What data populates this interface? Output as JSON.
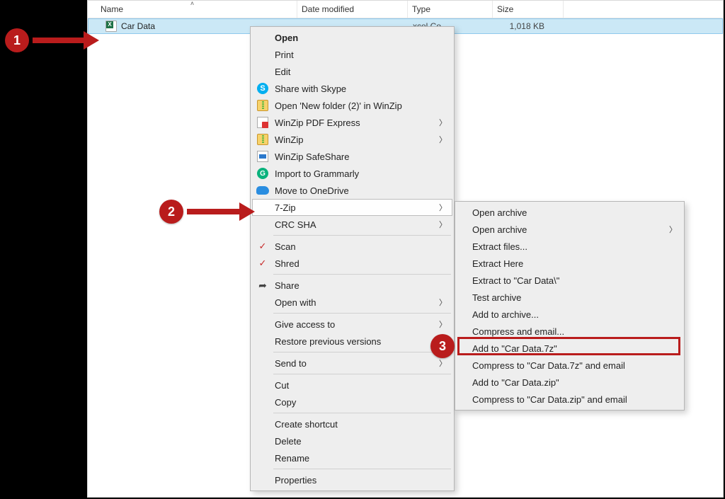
{
  "columns": {
    "name": "Name",
    "date": "Date modified",
    "type": "Type",
    "size": "Size"
  },
  "file": {
    "name": "Car Data",
    "date": "",
    "type": "xcel Co...",
    "size": "1,018 KB"
  },
  "menu": {
    "open": "Open",
    "print": "Print",
    "edit": "Edit",
    "skype": "Share with Skype",
    "winzip_open": "Open 'New folder (2)' in WinZip",
    "winzip_pdf": "WinZip PDF Express",
    "winzip": "WinZip",
    "winzip_safe": "WinZip SafeShare",
    "grammarly": "Import to Grammarly",
    "onedrive": "Move to OneDrive",
    "sevenzip": "7-Zip",
    "crcsha": "CRC SHA",
    "scan": "Scan",
    "shred": "Shred",
    "share": "Share",
    "openwith": "Open with",
    "giveaccess": "Give access to",
    "restore": "Restore previous versions",
    "sendto": "Send to",
    "cut": "Cut",
    "copy": "Copy",
    "shortcut": "Create shortcut",
    "delete": "Delete",
    "rename": "Rename",
    "properties": "Properties"
  },
  "submenu": {
    "open_archive1": "Open archive",
    "open_archive2": "Open archive",
    "extract_files": "Extract files...",
    "extract_here": "Extract Here",
    "extract_to": "Extract to \"Car Data\\\"",
    "test": "Test archive",
    "add_archive": "Add to archive...",
    "compress_email": "Compress and email...",
    "add_7z": "Add to \"Car Data.7z\"",
    "compress_7z_email": "Compress to \"Car Data.7z\" and email",
    "add_zip": "Add to \"Car Data.zip\"",
    "compress_zip_email": "Compress to \"Car Data.zip\" and email"
  },
  "annotations": {
    "n1": "1",
    "n2": "2",
    "n3": "3"
  }
}
